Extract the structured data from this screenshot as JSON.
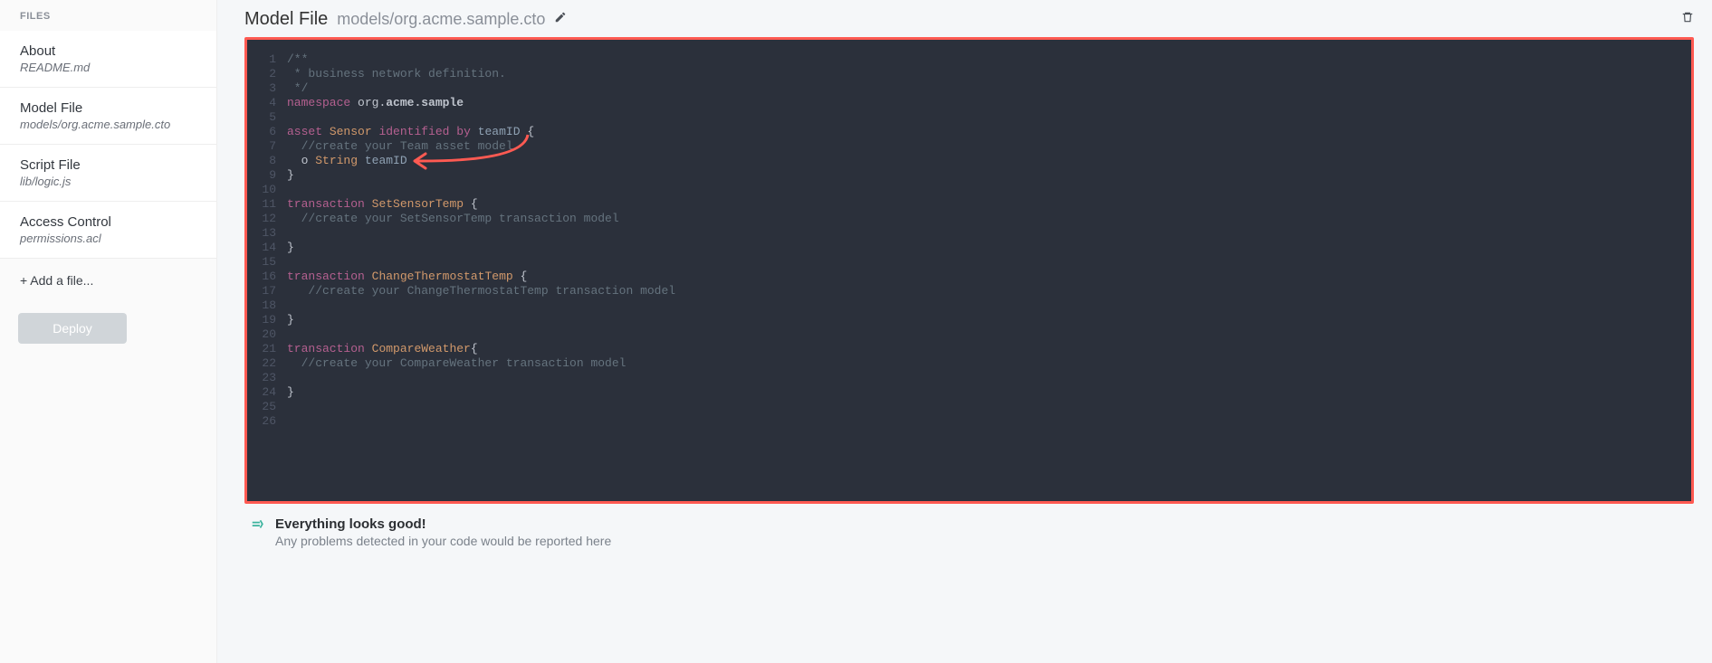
{
  "sidebar": {
    "header": "FILES",
    "items": [
      {
        "title": "About",
        "sub": "README.md"
      },
      {
        "title": "Model File",
        "sub": "models/org.acme.sample.cto"
      },
      {
        "title": "Script File",
        "sub": "lib/logic.js"
      },
      {
        "title": "Access Control",
        "sub": "permissions.acl"
      }
    ],
    "addFile": "+ Add a file...",
    "deploy": "Deploy"
  },
  "header": {
    "title": "Model File",
    "path": "models/org.acme.sample.cto"
  },
  "editor": {
    "lineCount": 26,
    "lines": [
      [
        {
          "t": "/**",
          "c": "cm"
        }
      ],
      [
        {
          "t": " * business network definition.",
          "c": "cm"
        }
      ],
      [
        {
          "t": " */",
          "c": "cm"
        }
      ],
      [
        {
          "t": "namespace",
          "c": "kw"
        },
        {
          "t": " ",
          "c": ""
        },
        {
          "t": "org",
          "c": ""
        },
        {
          "t": ".",
          "c": ""
        },
        {
          "t": "acme.sample",
          "c": "bold"
        }
      ],
      [],
      [
        {
          "t": "asset",
          "c": "kw"
        },
        {
          "t": " ",
          "c": ""
        },
        {
          "t": "Sensor",
          "c": "type"
        },
        {
          "t": " ",
          "c": ""
        },
        {
          "t": "identified",
          "c": "kw"
        },
        {
          "t": " ",
          "c": ""
        },
        {
          "t": "by",
          "c": "kw"
        },
        {
          "t": " ",
          "c": ""
        },
        {
          "t": "teamID",
          "c": "ident"
        },
        {
          "t": " {",
          "c": "punc"
        }
      ],
      [
        {
          "t": "  //create your Team asset model",
          "c": "cm"
        }
      ],
      [
        {
          "t": "  o ",
          "c": ""
        },
        {
          "t": "String",
          "c": "type"
        },
        {
          "t": " ",
          "c": ""
        },
        {
          "t": "teamID",
          "c": "ident"
        }
      ],
      [
        {
          "t": "}",
          "c": "punc"
        }
      ],
      [],
      [
        {
          "t": "transaction",
          "c": "kw"
        },
        {
          "t": " ",
          "c": ""
        },
        {
          "t": "SetSensorTemp",
          "c": "type"
        },
        {
          "t": " {",
          "c": "punc"
        }
      ],
      [
        {
          "t": "  //create your SetSensorTemp transaction model",
          "c": "cm"
        }
      ],
      [],
      [
        {
          "t": "}",
          "c": "punc"
        }
      ],
      [],
      [
        {
          "t": "transaction",
          "c": "kw"
        },
        {
          "t": " ",
          "c": ""
        },
        {
          "t": "ChangeThermostatTemp",
          "c": "type"
        },
        {
          "t": " {",
          "c": "punc"
        }
      ],
      [
        {
          "t": "   //create your ChangeThermostatTemp transaction model",
          "c": "cm"
        }
      ],
      [],
      [
        {
          "t": "}",
          "c": "punc"
        }
      ],
      [],
      [
        {
          "t": "transaction",
          "c": "kw"
        },
        {
          "t": " ",
          "c": ""
        },
        {
          "t": "CompareWeather",
          "c": "type"
        },
        {
          "t": "{",
          "c": "punc"
        }
      ],
      [
        {
          "t": "  //create your CompareWeather transaction model",
          "c": "cm"
        }
      ],
      [],
      [
        {
          "t": "}",
          "c": "punc"
        }
      ],
      [],
      []
    ]
  },
  "status": {
    "ok": "Everything looks good!",
    "sub": "Any problems detected in your code would be reported here"
  }
}
